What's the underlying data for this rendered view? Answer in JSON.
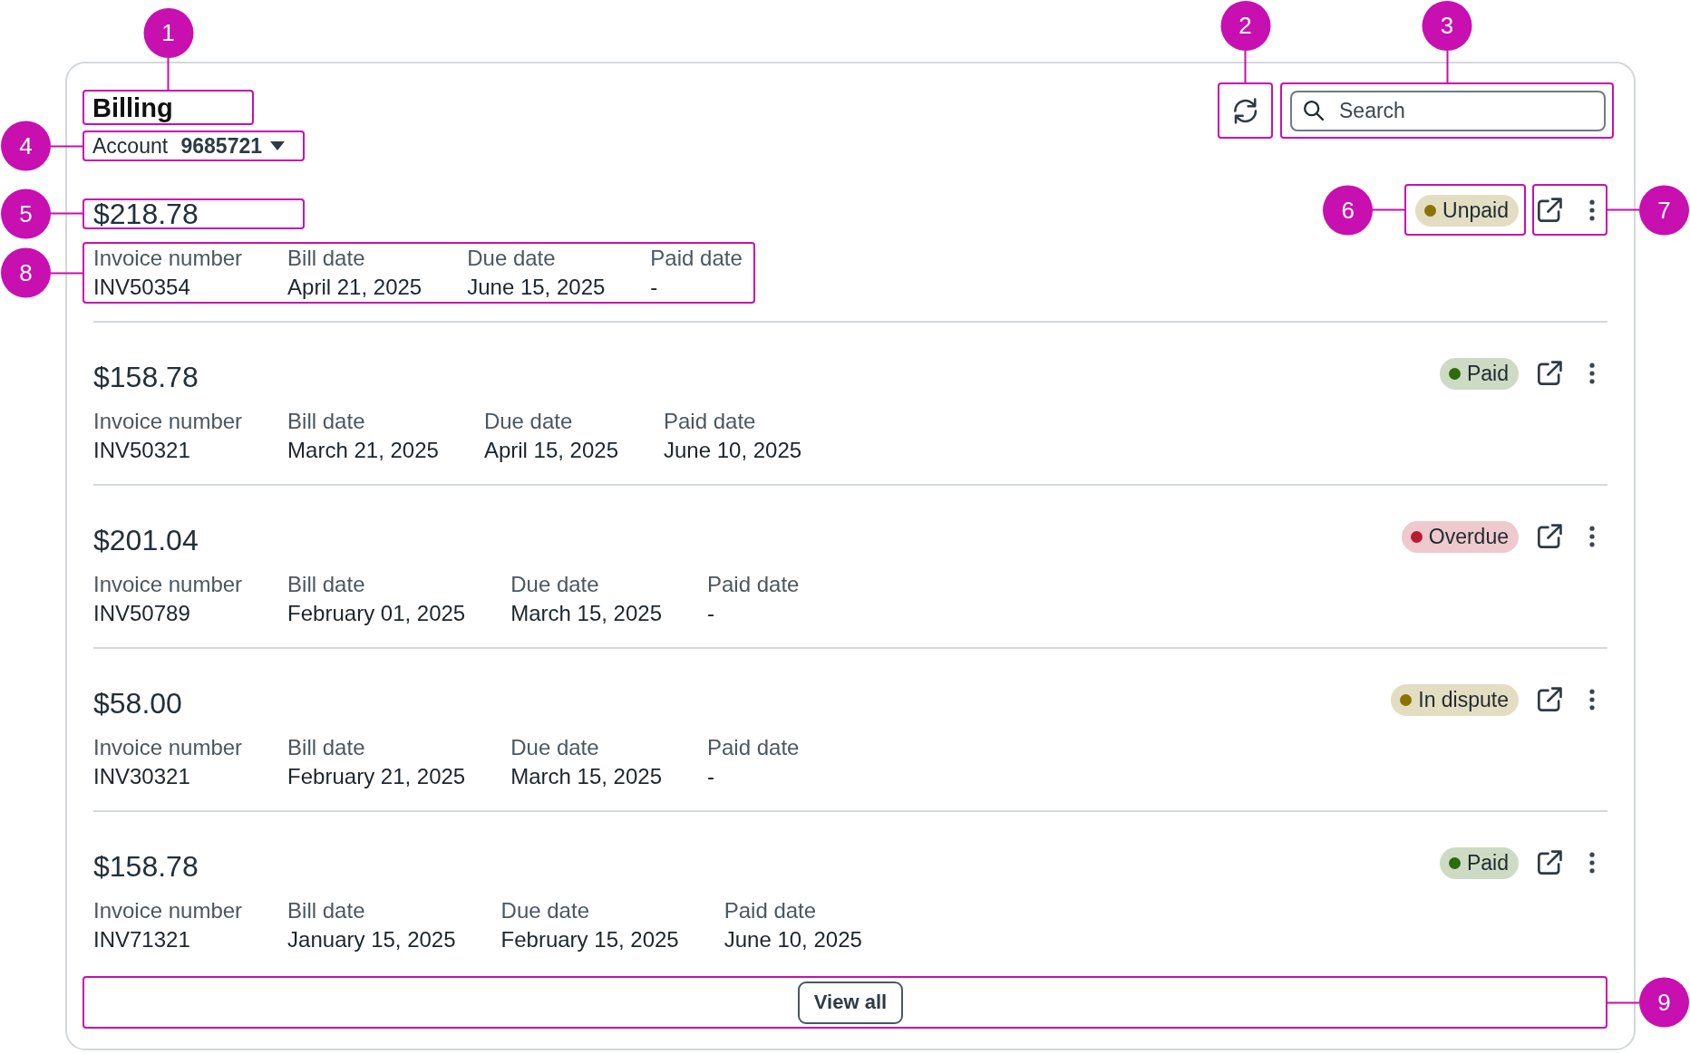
{
  "header": {
    "title": {
      "text": "Billing",
      "callout": "1"
    },
    "account": {
      "label": "Account",
      "number": "9685721",
      "callout": "4"
    },
    "refresh": {
      "callout": "2"
    },
    "search": {
      "placeholder": "Search",
      "callout": "3"
    }
  },
  "invoices": [
    {
      "amount": "$218.78",
      "amount_callout": "5",
      "status": {
        "label": "Unpaid",
        "color": "#8b7300"
      },
      "status_callout": "6",
      "actions_callout": "7",
      "fields": [
        {
          "label": "Invoice number",
          "value": "INV50354"
        },
        {
          "label": "Bill date",
          "value": "April 21, 2025"
        },
        {
          "label": "Due date",
          "value": "June 15, 2025"
        },
        {
          "label": "Paid date",
          "value": "-"
        }
      ],
      "fields_callout": "8"
    },
    {
      "amount": "$158.78",
      "status": {
        "label": "Paid",
        "color": "#2e6b0a"
      },
      "fields": [
        {
          "label": "Invoice number",
          "value": "INV50321"
        },
        {
          "label": "Bill date",
          "value": "March 21, 2025"
        },
        {
          "label": "Due date",
          "value": "April 15, 2025"
        },
        {
          "label": "Paid date",
          "value": "June 10, 2025"
        }
      ]
    },
    {
      "amount": "$201.04",
      "status": {
        "label": "Overdue",
        "color": "#b81c2e"
      },
      "fields": [
        {
          "label": "Invoice number",
          "value": "INV50789"
        },
        {
          "label": "Bill date",
          "value": "February 01, 2025"
        },
        {
          "label": "Due date",
          "value": "March 15, 2025"
        },
        {
          "label": "Paid date",
          "value": "-"
        }
      ]
    },
    {
      "amount": "$58.00",
      "status": {
        "label": "In dispute",
        "color": "#8b7300"
      },
      "fields": [
        {
          "label": "Invoice number",
          "value": "INV30321"
        },
        {
          "label": "Bill date",
          "value": "February 21, 2025"
        },
        {
          "label": "Due date",
          "value": "March 15, 2025"
        },
        {
          "label": "Paid date",
          "value": "-"
        }
      ]
    },
    {
      "amount": "$158.78",
      "status": {
        "label": "Paid",
        "color": "#2e6b0a"
      },
      "fields": [
        {
          "label": "Invoice number",
          "value": "INV71321"
        },
        {
          "label": "Bill date",
          "value": "January 15, 2025"
        },
        {
          "label": "Due date",
          "value": "February 15, 2025"
        },
        {
          "label": "Paid date",
          "value": "June 10, 2025"
        }
      ]
    }
  ],
  "view_all": {
    "label": "View all",
    "callout": "9"
  }
}
